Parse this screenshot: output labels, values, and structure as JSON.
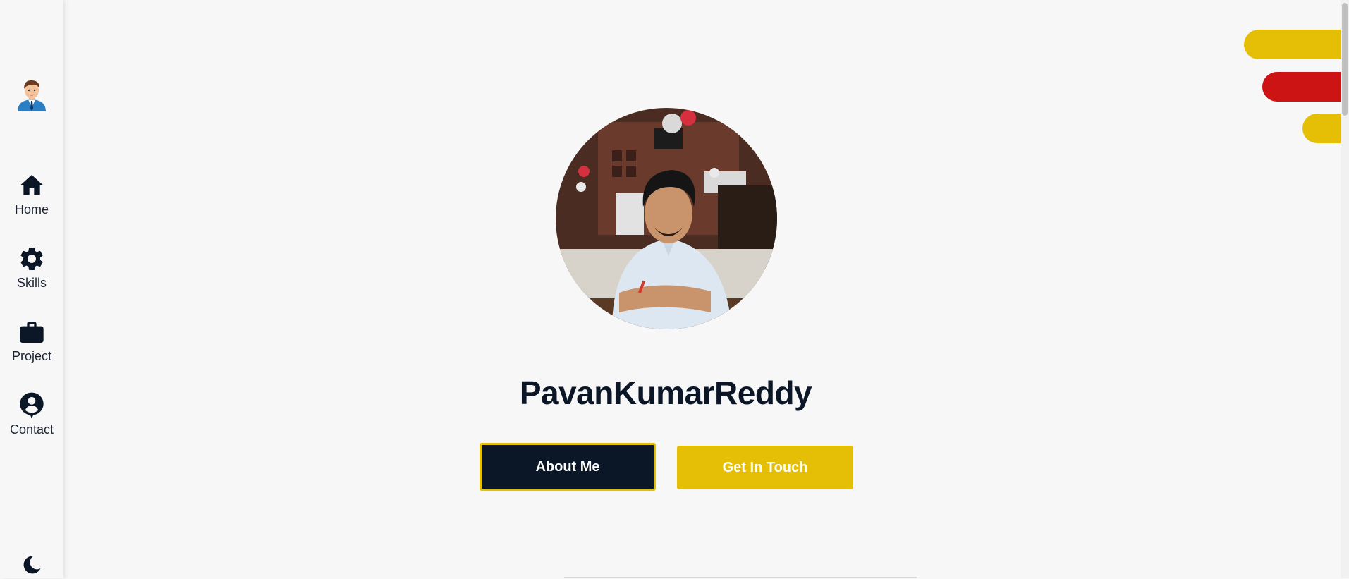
{
  "nav": {
    "items": [
      {
        "label": "Home",
        "icon": "home-icon"
      },
      {
        "label": "Skills",
        "icon": "gear-icon"
      },
      {
        "label": "Project",
        "icon": "briefcase-icon"
      },
      {
        "label": "Contact",
        "icon": "contact-icon"
      }
    ]
  },
  "hero": {
    "name": "PavanKumarReddy",
    "about_button": "About Me",
    "contact_button": "Get In Touch"
  },
  "colors": {
    "dark": "#0b1626",
    "accent_yellow": "#e5bf06",
    "accent_red": "#cd1414"
  }
}
